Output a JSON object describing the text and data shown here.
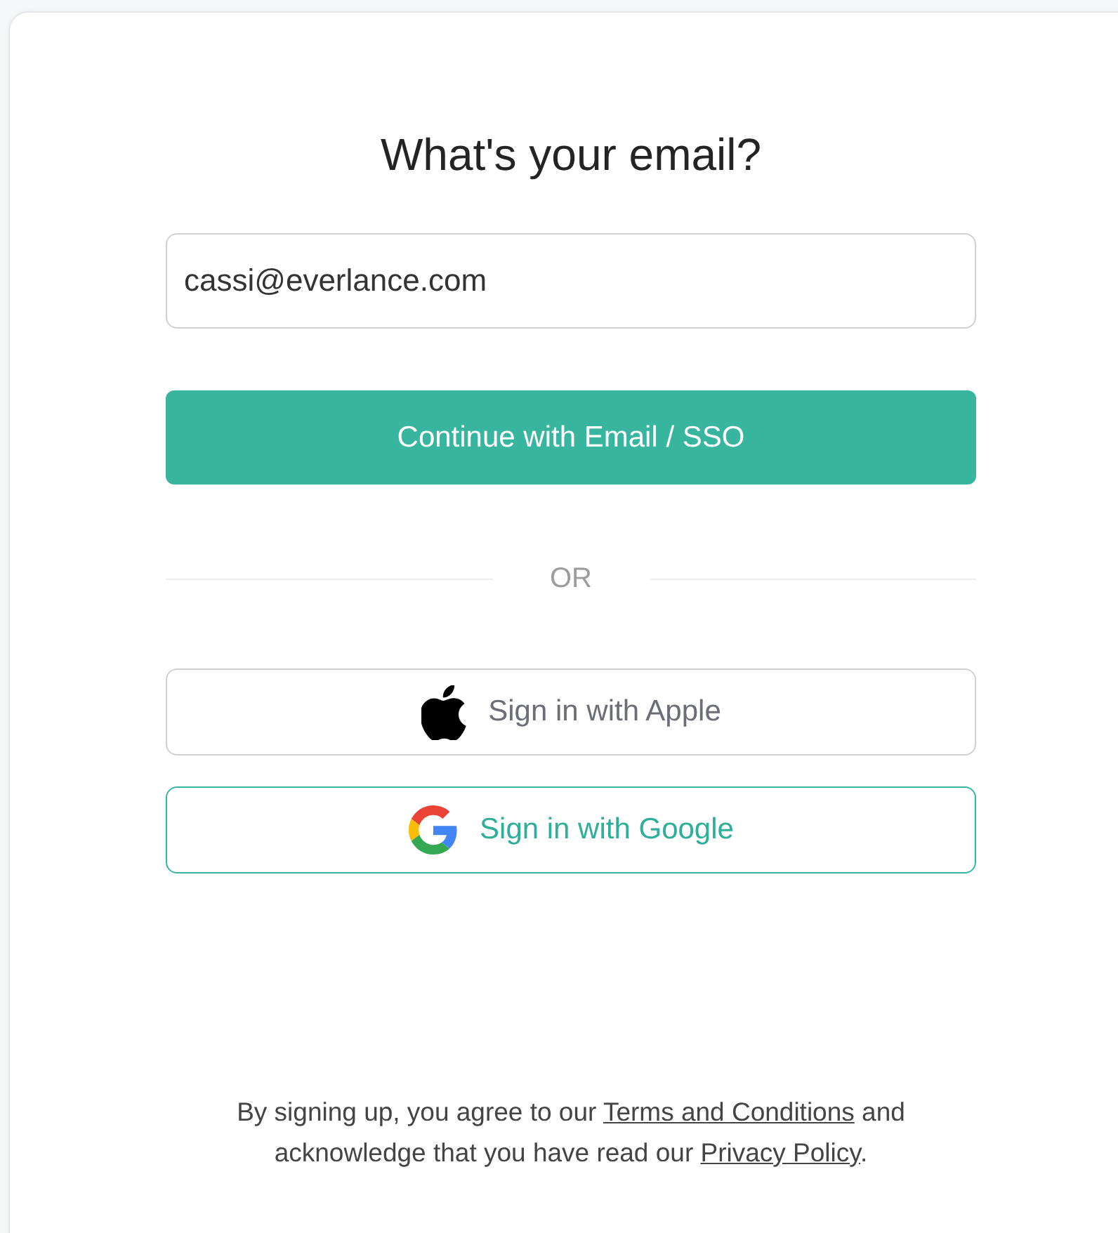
{
  "card": {
    "title": "What's your email?",
    "email_field": {
      "value": "cassi@everlance.com"
    },
    "continue_button": {
      "label": "Continue with Email / SSO"
    },
    "divider": {
      "label": "OR"
    },
    "providers": [
      {
        "kind": "apple",
        "label": "Sign in with Apple"
      },
      {
        "kind": "google",
        "label": "Sign in with Google"
      }
    ],
    "legal": [
      {
        "kind": "text",
        "text": "By signing up, you agree to our "
      },
      {
        "kind": "link",
        "text": "Terms and Conditions"
      },
      {
        "kind": "text",
        "text": " and acknowledge that you have read our "
      },
      {
        "kind": "link",
        "text": "Privacy Policy"
      },
      {
        "kind": "text",
        "text": "."
      }
    ]
  }
}
